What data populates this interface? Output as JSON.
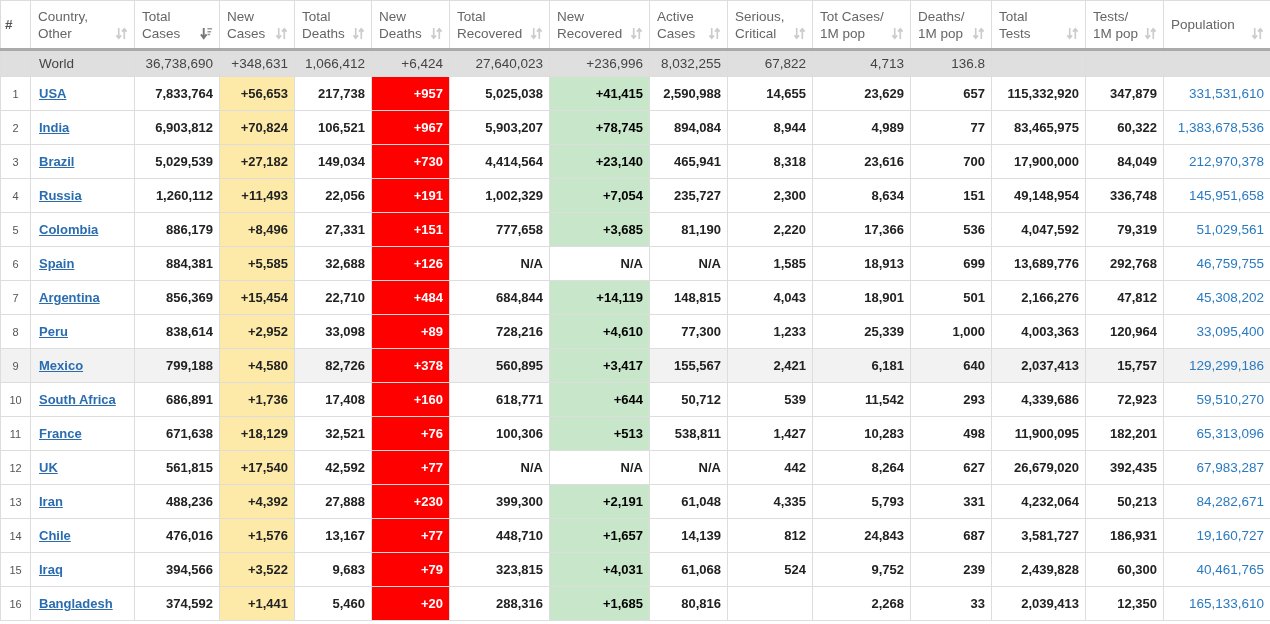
{
  "columns": [
    {
      "label": "#",
      "kind": "rank",
      "sorted": false
    },
    {
      "label": "Country,\nOther",
      "kind": "link",
      "sorted": false
    },
    {
      "label": "Total\nCases",
      "kind": "number",
      "sorted": true
    },
    {
      "label": "New\nCases",
      "kind": "new_cases",
      "sorted": false
    },
    {
      "label": "Total\nDeaths",
      "kind": "number",
      "sorted": false
    },
    {
      "label": "New\nDeaths",
      "kind": "new_deaths",
      "sorted": false
    },
    {
      "label": "Total\nRecovered",
      "kind": "number",
      "sorted": false
    },
    {
      "label": "New\nRecovered",
      "kind": "new_recovered",
      "sorted": false
    },
    {
      "label": "Active\nCases",
      "kind": "number",
      "sorted": false
    },
    {
      "label": "Serious,\nCritical",
      "kind": "number",
      "sorted": false
    },
    {
      "label": "Tot Cases/\n1M pop",
      "kind": "number",
      "sorted": false
    },
    {
      "label": "Deaths/\n1M pop",
      "kind": "number",
      "sorted": false
    },
    {
      "label": "Total\nTests",
      "kind": "number",
      "sorted": false
    },
    {
      "label": "Tests/\n1M pop",
      "kind": "number",
      "sorted": false
    },
    {
      "label": "Population",
      "kind": "population",
      "sorted": false
    }
  ],
  "world": {
    "cells": [
      "World",
      "36,738,690",
      "+348,631",
      "1,066,412",
      "+6,424",
      "27,640,023",
      "+236,996",
      "8,032,255",
      "67,822",
      "4,713",
      "136.8"
    ]
  },
  "rows": [
    {
      "cells": [
        "1",
        "USA",
        "7,833,764",
        "+56,653",
        "217,738",
        "+957",
        "5,025,038",
        "+41,415",
        "2,590,988",
        "14,655",
        "23,629",
        "657",
        "115,332,920",
        "347,879",
        "331,531,610"
      ],
      "recovered_shaded": true,
      "highlighted": false
    },
    {
      "cells": [
        "2",
        "India",
        "6,903,812",
        "+70,824",
        "106,521",
        "+967",
        "5,903,207",
        "+78,745",
        "894,084",
        "8,944",
        "4,989",
        "77",
        "83,465,975",
        "60,322",
        "1,383,678,536"
      ],
      "recovered_shaded": true,
      "highlighted": false
    },
    {
      "cells": [
        "3",
        "Brazil",
        "5,029,539",
        "+27,182",
        "149,034",
        "+730",
        "4,414,564",
        "+23,140",
        "465,941",
        "8,318",
        "23,616",
        "700",
        "17,900,000",
        "84,049",
        "212,970,378"
      ],
      "recovered_shaded": true,
      "highlighted": false
    },
    {
      "cells": [
        "4",
        "Russia",
        "1,260,112",
        "+11,493",
        "22,056",
        "+191",
        "1,002,329",
        "+7,054",
        "235,727",
        "2,300",
        "8,634",
        "151",
        "49,148,954",
        "336,748",
        "145,951,658"
      ],
      "recovered_shaded": true,
      "highlighted": false
    },
    {
      "cells": [
        "5",
        "Colombia",
        "886,179",
        "+8,496",
        "27,331",
        "+151",
        "777,658",
        "+3,685",
        "81,190",
        "2,220",
        "17,366",
        "536",
        "4,047,592",
        "79,319",
        "51,029,561"
      ],
      "recovered_shaded": true,
      "highlighted": false
    },
    {
      "cells": [
        "6",
        "Spain",
        "884,381",
        "+5,585",
        "32,688",
        "+126",
        "N/A",
        "N/A",
        "N/A",
        "1,585",
        "18,913",
        "699",
        "13,689,776",
        "292,768",
        "46,759,755"
      ],
      "recovered_shaded": false,
      "highlighted": false
    },
    {
      "cells": [
        "7",
        "Argentina",
        "856,369",
        "+15,454",
        "22,710",
        "+484",
        "684,844",
        "+14,119",
        "148,815",
        "4,043",
        "18,901",
        "501",
        "2,166,276",
        "47,812",
        "45,308,202"
      ],
      "recovered_shaded": true,
      "highlighted": false
    },
    {
      "cells": [
        "8",
        "Peru",
        "838,614",
        "+2,952",
        "33,098",
        "+89",
        "728,216",
        "+4,610",
        "77,300",
        "1,233",
        "25,339",
        "1,000",
        "4,003,363",
        "120,964",
        "33,095,400"
      ],
      "recovered_shaded": true,
      "highlighted": false
    },
    {
      "cells": [
        "9",
        "Mexico",
        "799,188",
        "+4,580",
        "82,726",
        "+378",
        "560,895",
        "+3,417",
        "155,567",
        "2,421",
        "6,181",
        "640",
        "2,037,413",
        "15,757",
        "129,299,186"
      ],
      "recovered_shaded": true,
      "highlighted": true
    },
    {
      "cells": [
        "10",
        "South Africa",
        "686,891",
        "+1,736",
        "17,408",
        "+160",
        "618,771",
        "+644",
        "50,712",
        "539",
        "11,542",
        "293",
        "4,339,686",
        "72,923",
        "59,510,270"
      ],
      "recovered_shaded": true,
      "highlighted": false
    },
    {
      "cells": [
        "11",
        "France",
        "671,638",
        "+18,129",
        "32,521",
        "+76",
        "100,306",
        "+513",
        "538,811",
        "1,427",
        "10,283",
        "498",
        "11,900,095",
        "182,201",
        "65,313,096"
      ],
      "recovered_shaded": true,
      "highlighted": false
    },
    {
      "cells": [
        "12",
        "UK",
        "561,815",
        "+17,540",
        "42,592",
        "+77",
        "N/A",
        "N/A",
        "N/A",
        "442",
        "8,264",
        "627",
        "26,679,020",
        "392,435",
        "67,983,287"
      ],
      "recovered_shaded": false,
      "highlighted": false
    },
    {
      "cells": [
        "13",
        "Iran",
        "488,236",
        "+4,392",
        "27,888",
        "+230",
        "399,300",
        "+2,191",
        "61,048",
        "4,335",
        "5,793",
        "331",
        "4,232,064",
        "50,213",
        "84,282,671"
      ],
      "recovered_shaded": true,
      "highlighted": false
    },
    {
      "cells": [
        "14",
        "Chile",
        "476,016",
        "+1,576",
        "13,167",
        "+77",
        "448,710",
        "+1,657",
        "14,139",
        "812",
        "24,843",
        "687",
        "3,581,727",
        "186,931",
        "19,160,727"
      ],
      "recovered_shaded": true,
      "highlighted": false
    },
    {
      "cells": [
        "15",
        "Iraq",
        "394,566",
        "+3,522",
        "9,683",
        "+79",
        "323,815",
        "+4,031",
        "61,068",
        "524",
        "9,752",
        "239",
        "2,439,828",
        "60,300",
        "40,461,765"
      ],
      "recovered_shaded": true,
      "highlighted": false
    },
    {
      "cells": [
        "16",
        "Bangladesh",
        "374,592",
        "+1,441",
        "5,460",
        "+20",
        "288,316",
        "+1,685",
        "80,816",
        null,
        "2,268",
        "33",
        "2,039,413",
        "12,350",
        "165,133,610"
      ],
      "recovered_shaded": true,
      "highlighted": false
    }
  ]
}
